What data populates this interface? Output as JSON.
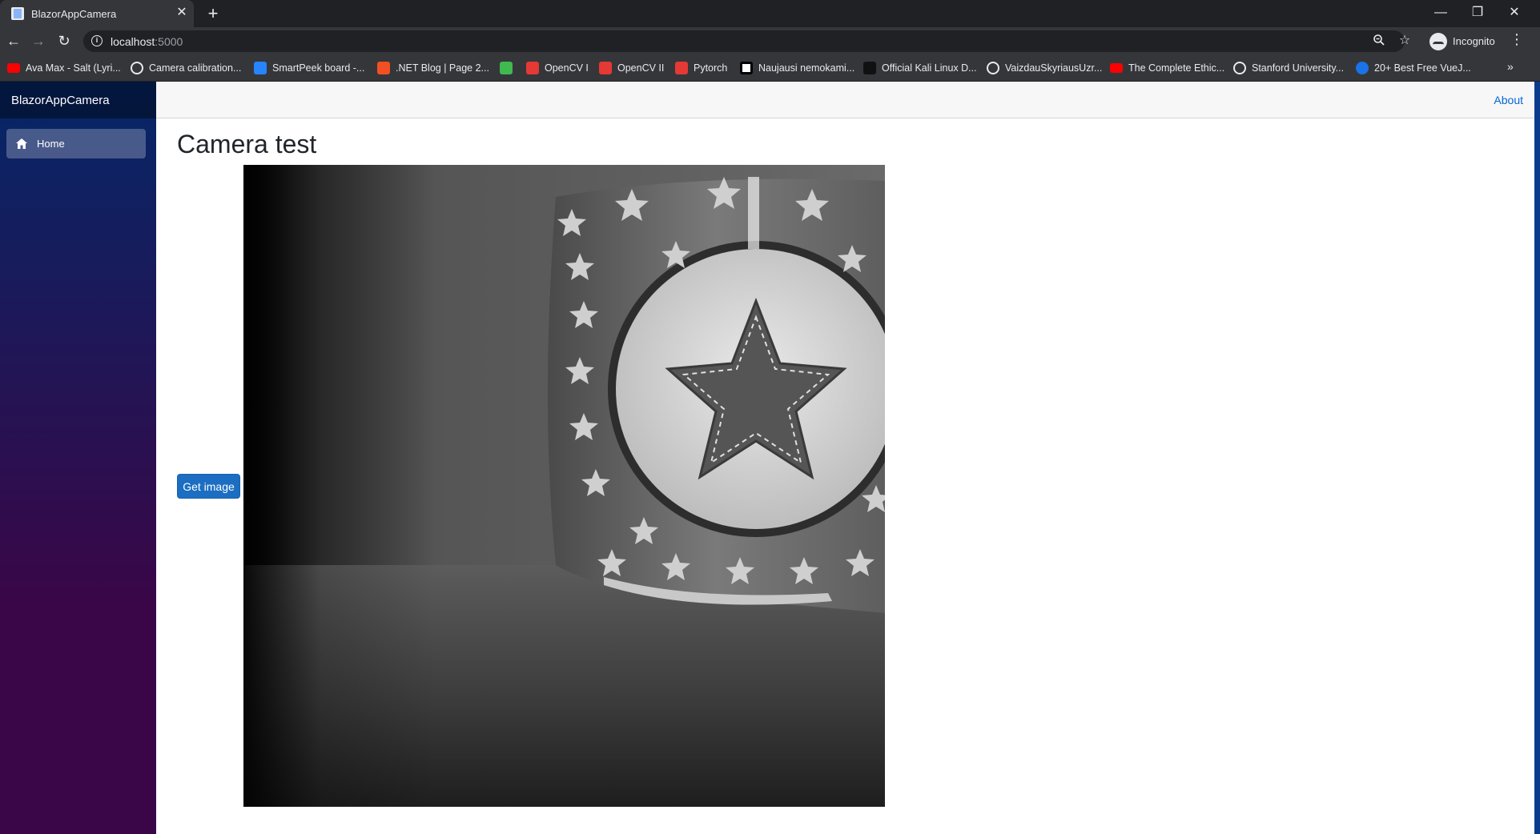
{
  "browser": {
    "tab": {
      "title": "BlazorAppCamera",
      "close_glyph": "✕"
    },
    "new_tab_glyph": "+",
    "window_controls": {
      "minimize": "—",
      "restore": "❐",
      "close": "✕"
    },
    "nav": {
      "back": "←",
      "forward": "→",
      "reload": "↻"
    },
    "address": {
      "host": "localhost",
      "port": ":5000"
    },
    "zoom_icon": "zoom-icon",
    "star_glyph": "☆",
    "profile_label": "Incognito",
    "menu_glyph": "⋮",
    "bookmarks": [
      {
        "label": "Ava Max - Salt (Lyri...",
        "icon": "youtube-icon",
        "color": "#ff0000"
      },
      {
        "label": "Camera calibration...",
        "icon": "globe-icon",
        "color": "#e8eaed"
      },
      {
        "label": "SmartPeek board -...",
        "icon": "jira-icon",
        "color": "#2684ff"
      },
      {
        "label": ".NET Blog | Page 2...",
        "icon": "microsoft-icon",
        "color": "#f25022"
      },
      {
        "label": "",
        "icon": "github-icon",
        "color": "#3fb950"
      },
      {
        "label": "OpenCV I",
        "icon": "opencv-icon",
        "color": "#e53935"
      },
      {
        "label": "OpenCV II",
        "icon": "opencv-icon",
        "color": "#e53935"
      },
      {
        "label": "Pytorch",
        "icon": "opencv-icon",
        "color": "#e53935"
      },
      {
        "label": "Naujausi nemokami...",
        "icon": "f-icon",
        "color": "#000000"
      },
      {
        "label": "Official Kali Linux D...",
        "icon": "kali-icon",
        "color": "#111111"
      },
      {
        "label": "VaizdauSkyriausUzr...",
        "icon": "globe-icon",
        "color": "#e8eaed"
      },
      {
        "label": "The Complete Ethic...",
        "icon": "youtube-icon",
        "color": "#ff0000"
      },
      {
        "label": "Stanford University...",
        "icon": "globe-icon",
        "color": "#e8eaed"
      },
      {
        "label": "20+ Best Free VueJ...",
        "icon": "c-icon",
        "color": "#1a73e8"
      }
    ],
    "bookmarks_more": "»"
  },
  "app": {
    "brand": "BlazorAppCamera",
    "nav": {
      "home_label": "Home"
    },
    "top_links": {
      "about": "About"
    },
    "page": {
      "title": "Camera test",
      "button_label": "Get image"
    }
  }
}
